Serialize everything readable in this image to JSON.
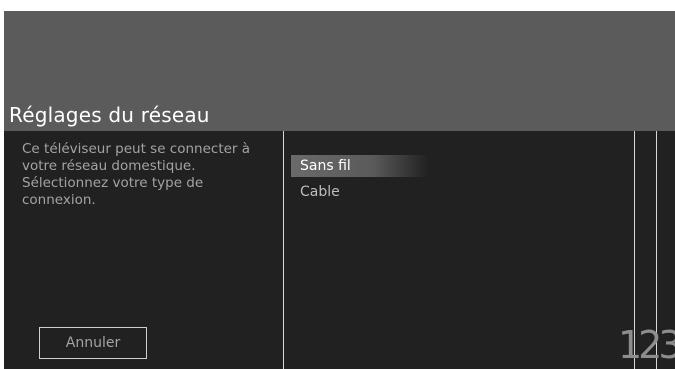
{
  "header": {
    "title": "Réglages du réseau"
  },
  "description": "Ce téléviseur peut se connecter à votre réseau domestique. Sélectionnez votre type de connexion.",
  "options": [
    {
      "label": "Sans fil",
      "selected": true
    },
    {
      "label": "Cable",
      "selected": false
    }
  ],
  "cancel_label": "Annuler",
  "channel_number": "123",
  "colors": {
    "header_bg": "#5b5b5b",
    "body_bg": "#212121",
    "highlight": "#6a6a6a",
    "text_primary": "#ffffff",
    "text_secondary": "#a3a3a3"
  }
}
